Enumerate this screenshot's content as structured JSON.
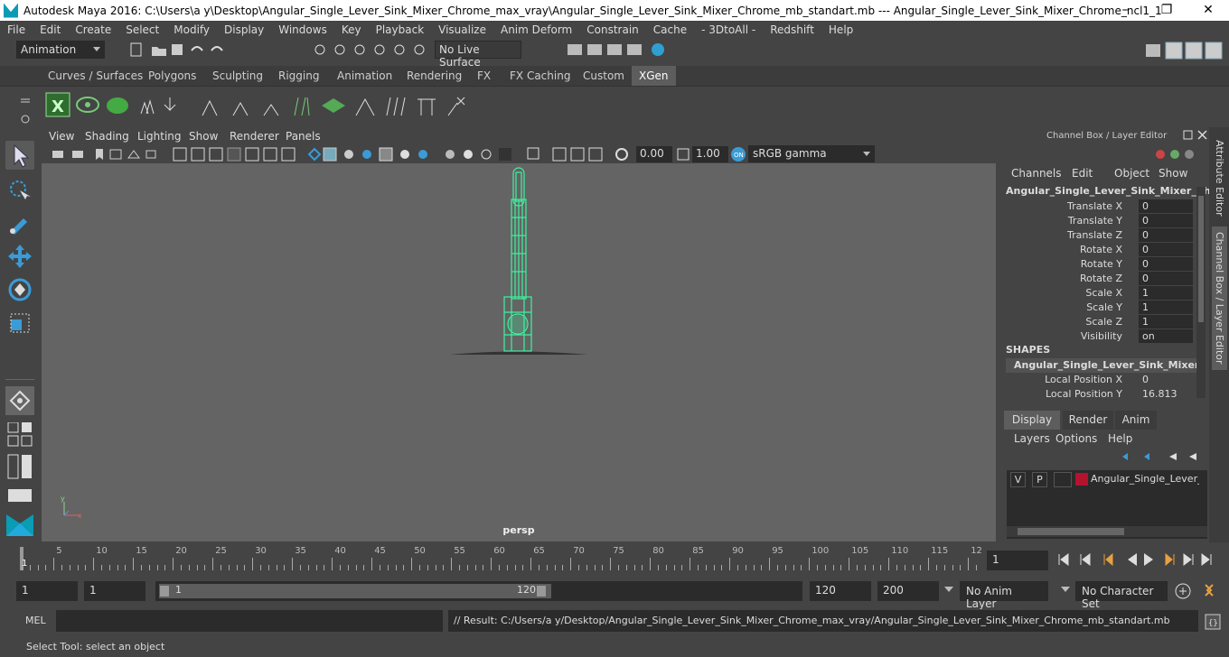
{
  "window": {
    "title": "Autodesk Maya 2016: C:\\Users\\a y\\Desktop\\Angular_Single_Lever_Sink_Mixer_Chrome_max_vray\\Angular_Single_Lever_Sink_Mixer_Chrome_mb_standart.mb   ---   Angular_Single_Lever_Sink_Mixer_Chrome_ncl1_1",
    "minimize": "–",
    "maximize": "❐",
    "close": "✕"
  },
  "menubar": [
    "File",
    "Edit",
    "Create",
    "Select",
    "Modify",
    "Display",
    "Windows",
    "Key",
    "Playback",
    "Visualize",
    "Anim Deform",
    "Constrain",
    "Cache",
    "- 3DtoAll -",
    "Redshift",
    "Help"
  ],
  "statusline": {
    "menuset": "Animation",
    "live_surface": "No Live Surface"
  },
  "shelf_tabs": [
    "Curves / Surfaces",
    "Polygons",
    "Sculpting",
    "Rigging",
    "Animation",
    "Rendering",
    "FX",
    "FX Caching",
    "Custom",
    "XGen"
  ],
  "active_shelf_tab": "XGen",
  "viewport": {
    "menus": [
      "View",
      "Shading",
      "Lighting",
      "Show",
      "Renderer",
      "Panels"
    ],
    "exposure": "0.00",
    "gamma": "1.00",
    "color_space": "sRGB gamma",
    "camera": "persp"
  },
  "channel_box": {
    "header": "Channel Box / Layer Editor",
    "menus": [
      "Channels",
      "Edit",
      "Object",
      "Show"
    ],
    "object_name": "Angular_Single_Lever_Sink_Mixer_Chr...",
    "channels": [
      {
        "label": "Translate X",
        "value": "0"
      },
      {
        "label": "Translate Y",
        "value": "0"
      },
      {
        "label": "Translate Z",
        "value": "0"
      },
      {
        "label": "Rotate X",
        "value": "0"
      },
      {
        "label": "Rotate Y",
        "value": "0"
      },
      {
        "label": "Rotate Z",
        "value": "0"
      },
      {
        "label": "Scale X",
        "value": "1"
      },
      {
        "label": "Scale Y",
        "value": "1"
      },
      {
        "label": "Scale Z",
        "value": "1"
      },
      {
        "label": "Visibility",
        "value": "on"
      }
    ],
    "shapes_header": "SHAPES",
    "shape_name": "Angular_Single_Lever_Sink_Mixer_C...",
    "shape_channels": [
      {
        "label": "Local Position X",
        "value": "0"
      },
      {
        "label": "Local Position Y",
        "value": "16.813"
      }
    ]
  },
  "layer_editor": {
    "tabs": [
      "Display",
      "Render",
      "Anim"
    ],
    "active_tab": "Display",
    "menus": [
      "Layers",
      "Options",
      "Help"
    ],
    "layer": {
      "v": "V",
      "p": "P",
      "name": "Angular_Single_Lever_Sink",
      "color": "#b5122e"
    }
  },
  "side_tabs": [
    "Attribute Editor",
    "Channel Box / Layer Editor"
  ],
  "timeline": {
    "ticks": [
      "5",
      "10",
      "15",
      "20",
      "25",
      "30",
      "35",
      "40",
      "45",
      "50",
      "55",
      "60",
      "65",
      "70",
      "75",
      "80",
      "85",
      "90",
      "95",
      "100",
      "105",
      "110",
      "115",
      "12"
    ],
    "start_marker": "1",
    "current_frame": "1"
  },
  "range": {
    "start": "1",
    "anim_start": "1",
    "slider_start": "1",
    "slider_end": "120",
    "end": "120",
    "anim_end": "200",
    "anim_layer": "No Anim Layer",
    "character_set": "No Character Set"
  },
  "command": {
    "lang": "MEL",
    "result": "// Result: C:/Users/a y/Desktop/Angular_Single_Lever_Sink_Mixer_Chrome_max_vray/Angular_Single_Lever_Sink_Mixer_Chrome_mb_standart.mb"
  },
  "help_line": "Select Tool: select an object",
  "colors": {
    "wireframe": "#3df2a0",
    "active_tab": "#5d5d5d",
    "viewport_bg": "#646464"
  }
}
